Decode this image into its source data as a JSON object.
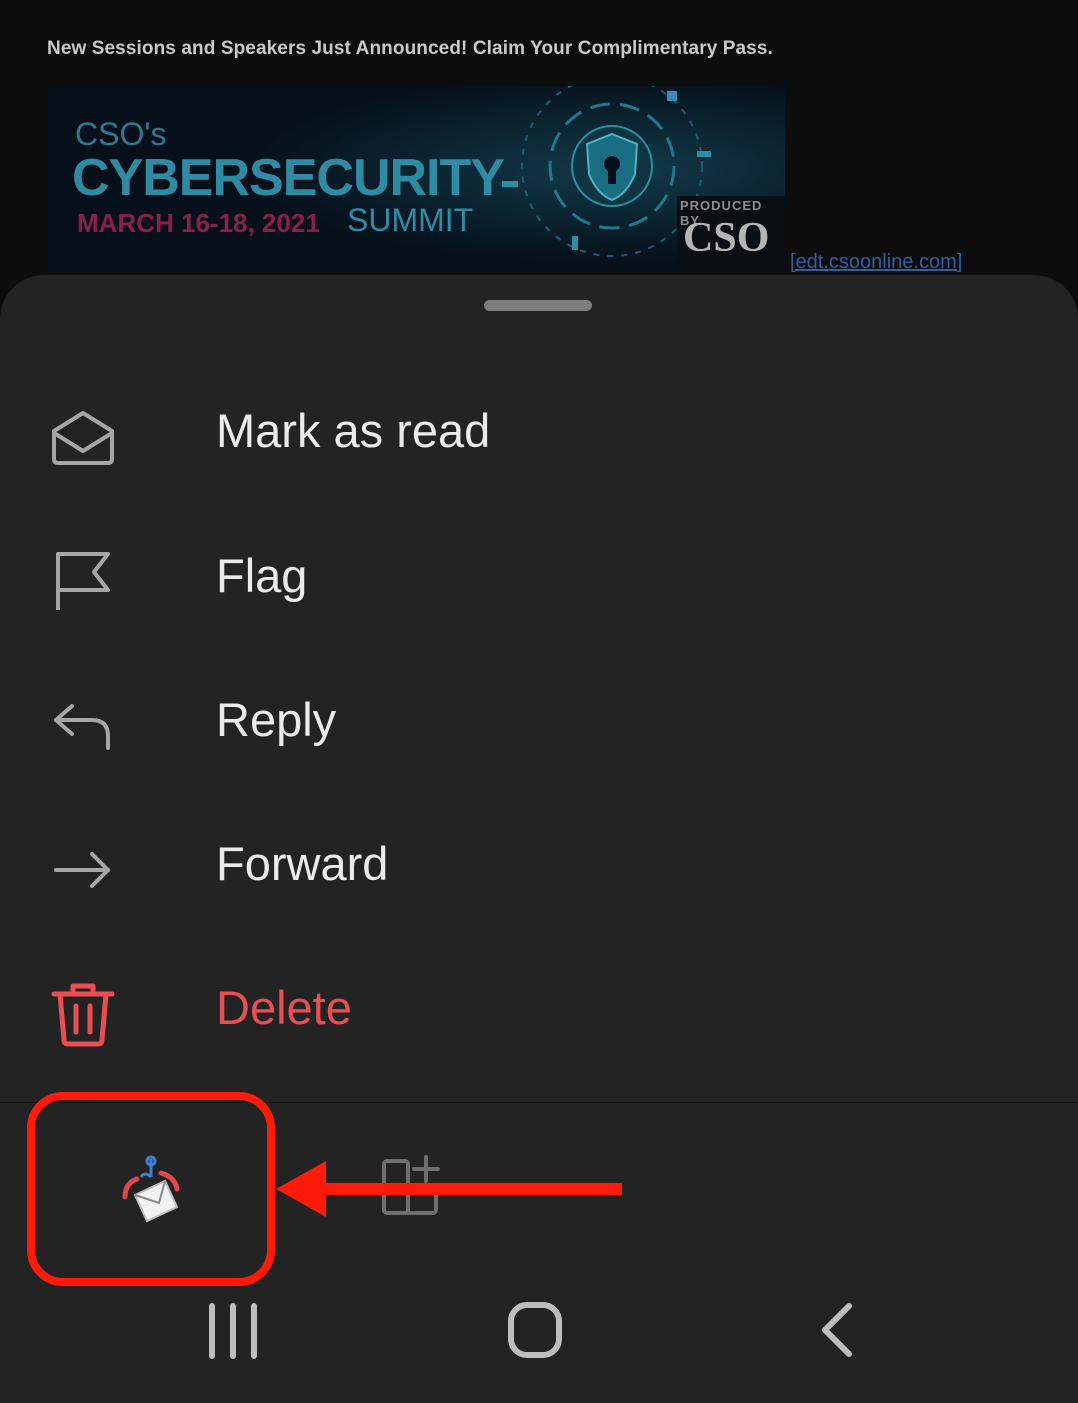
{
  "email": {
    "headline": "New Sessions and Speakers Just Announced! Claim Your Complimentary Pass.",
    "banner": {
      "line1": "CSO's",
      "line2": "CYBERSECURITY",
      "dates": "MARCH 16-18, 2021",
      "summit": "SUMMIT",
      "produced_by": "PRODUCED BY",
      "producer": "CSO"
    },
    "link_text": "[edt.csoonline.com]"
  },
  "sheet": {
    "items": [
      {
        "label": "Mark as read",
        "icon": "envelope-open-icon"
      },
      {
        "label": "Flag",
        "icon": "flag-icon"
      },
      {
        "label": "Reply",
        "icon": "reply-icon"
      },
      {
        "label": "Forward",
        "icon": "forward-icon"
      },
      {
        "label": "Delete",
        "icon": "trash-icon",
        "danger": true
      }
    ],
    "addins": [
      {
        "icon": "phishing-report-icon"
      },
      {
        "icon": "add-apps-icon"
      }
    ]
  },
  "annotation": {
    "highlight_color": "#ff1a0a"
  },
  "colors": {
    "sheet": "#232323",
    "text": "#ebebeb",
    "danger": "#ea4e54",
    "icon": "#a6a6a6"
  },
  "navbar": {
    "buttons": [
      "recents-icon",
      "home-icon",
      "back-icon"
    ]
  }
}
